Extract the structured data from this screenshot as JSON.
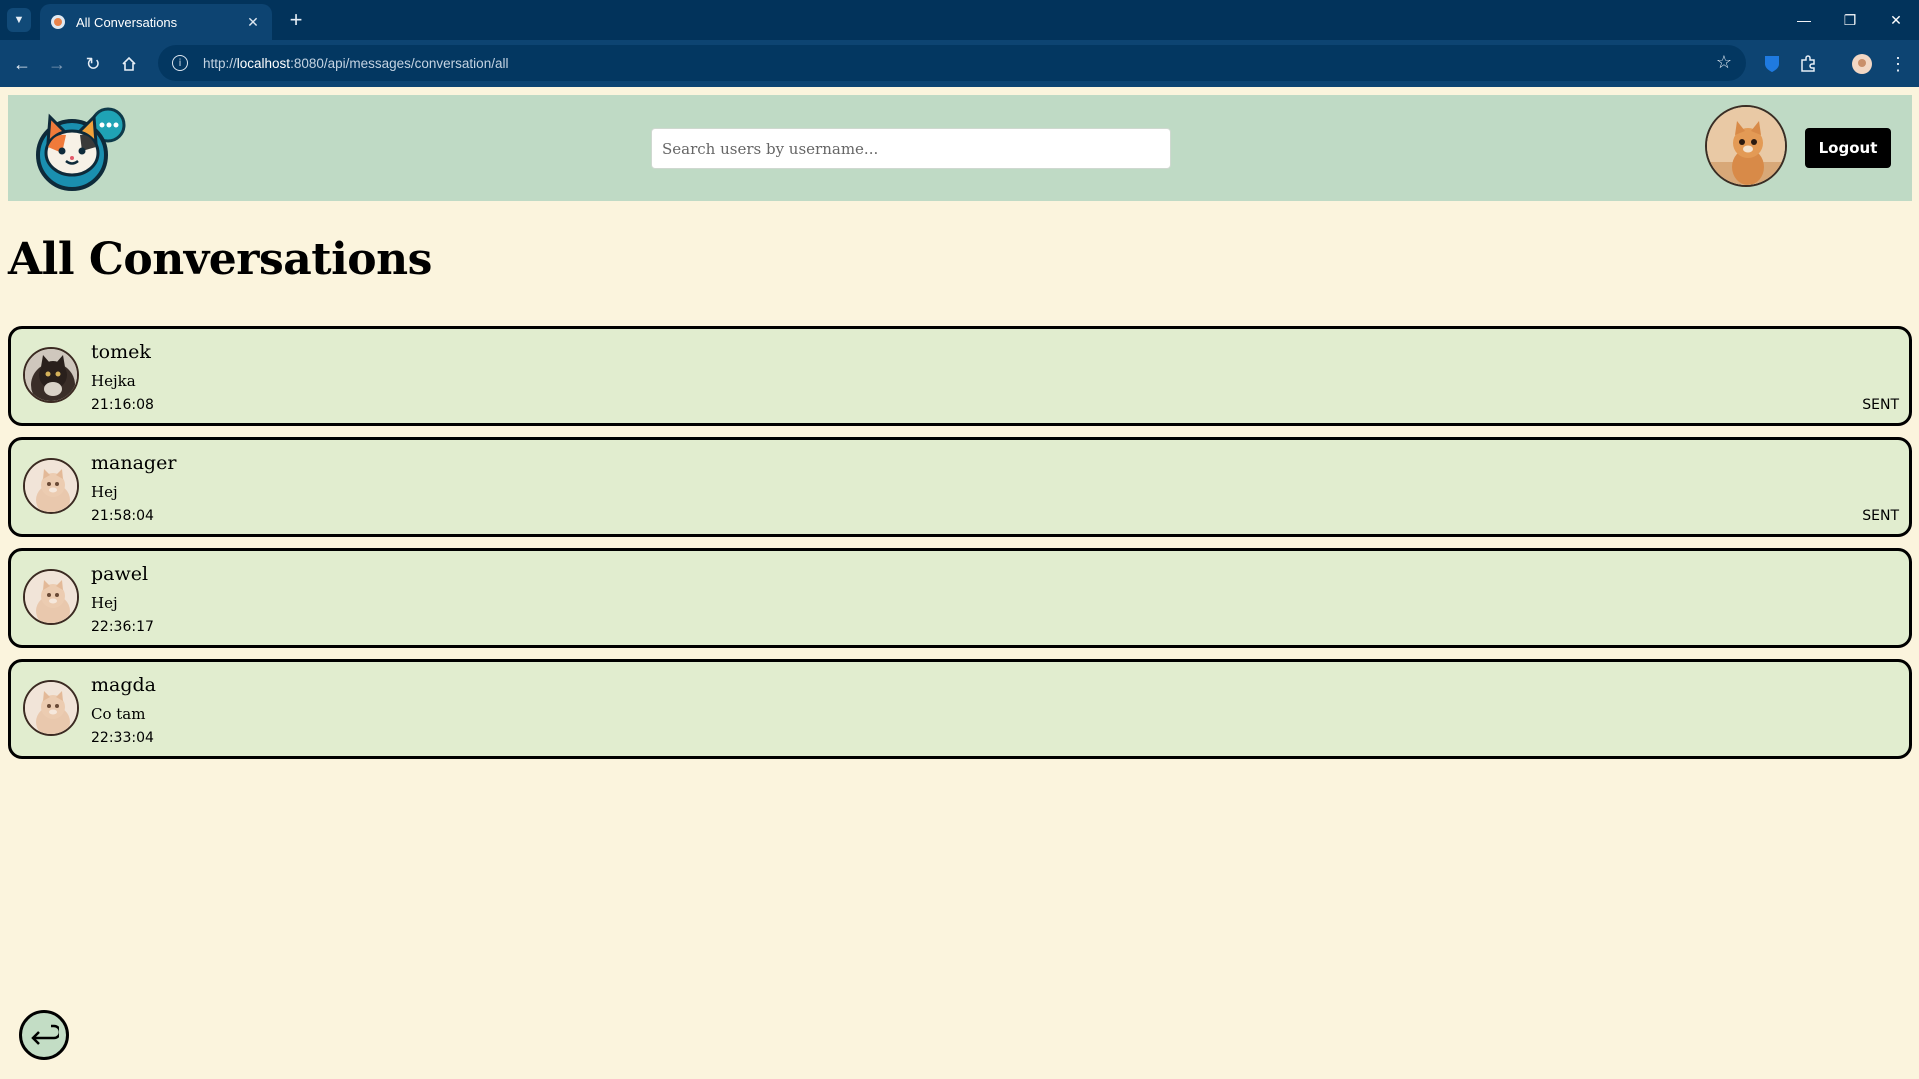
{
  "browser": {
    "tab_title": "All Conversations",
    "url_scheme": "http://",
    "url_host": "localhost",
    "url_path": ":8080/api/messages/conversation/all"
  },
  "header": {
    "search_placeholder": "Search users by username...",
    "logout_label": "Logout"
  },
  "page": {
    "title": "All Conversations"
  },
  "conversations": [
    {
      "name": "tomek",
      "message": "Hejka",
      "time": "21:16:08",
      "status": "SENT",
      "avatar": "dark-cat"
    },
    {
      "name": "manager",
      "message": "Hej",
      "time": "21:58:04",
      "status": "SENT",
      "avatar": "cream-cat"
    },
    {
      "name": "pawel",
      "message": "Hej",
      "time": "22:36:17",
      "status": "",
      "avatar": "cream-cat"
    },
    {
      "name": "magda",
      "message": "Co tam",
      "time": "22:33:04",
      "status": "",
      "avatar": "cream-cat"
    }
  ],
  "colors": {
    "page_background": "#fbf4dd",
    "header_background": "#bfdac5",
    "card_background": "#e1edcf",
    "browser_frame": "#02335b"
  }
}
